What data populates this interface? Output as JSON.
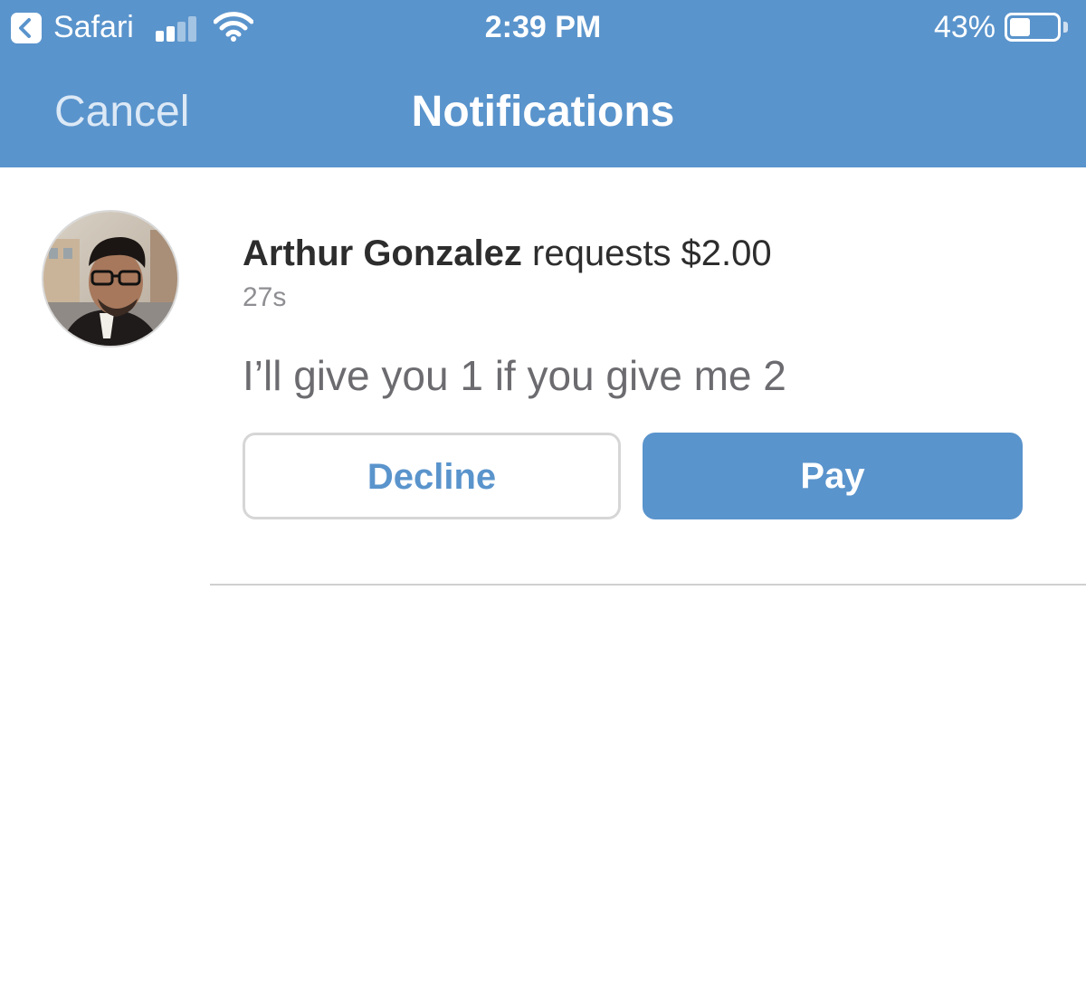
{
  "status_bar": {
    "back_app_label": "Safari",
    "time": "2:39 PM",
    "battery_percent_label": "43%",
    "battery_level": 0.43,
    "signal_bars_active": 2,
    "signal_bars_total": 4
  },
  "nav": {
    "cancel_label": "Cancel",
    "title": "Notifications"
  },
  "notification": {
    "requester_name": "Arthur Gonzalez",
    "action_text": " requests $2.00",
    "time_ago": "27s",
    "message": "I’ll give you 1 if you give me 2",
    "decline_label": "Decline",
    "pay_label": "Pay"
  },
  "colors": {
    "brand_blue": "#5a94cc",
    "divider": "#d0d0d0"
  }
}
